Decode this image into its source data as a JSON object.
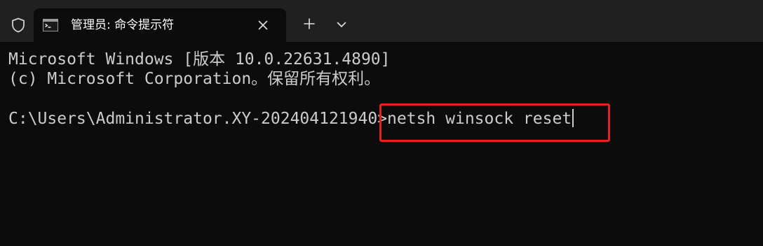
{
  "tab": {
    "title": "管理员: 命令提示符",
    "icon": "cmd-icon"
  },
  "toolbar": {
    "shield_icon": "shield-icon",
    "close_icon": "close-icon",
    "new_tab_icon": "plus-icon",
    "dropdown_icon": "chevron-down-icon"
  },
  "terminal": {
    "lines": [
      "Microsoft Windows [版本 10.0.22631.4890]",
      "(c) Microsoft Corporation。保留所有权利。",
      ""
    ],
    "prompt": "C:\\Users\\Administrator.XY-202404121940>",
    "command": "netsh winsock reset"
  },
  "colors": {
    "titlebar": "#202020",
    "background": "#0c0c0c",
    "text": "#cccccc",
    "highlight": "#e3221c"
  }
}
